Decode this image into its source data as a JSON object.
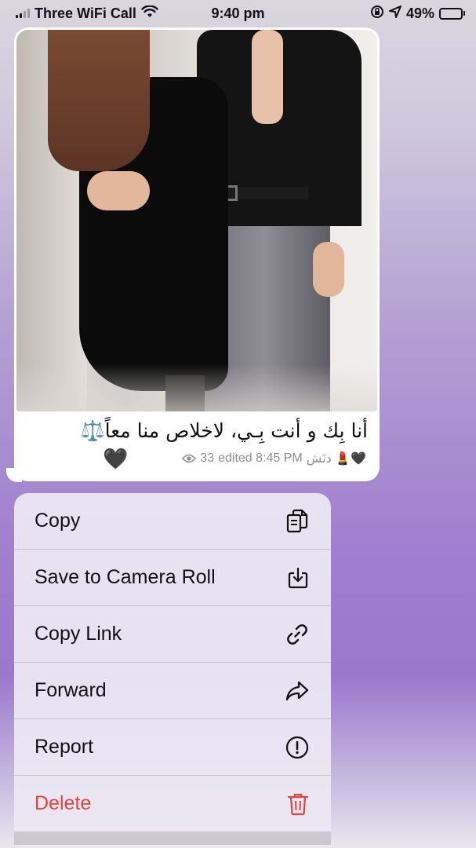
{
  "status_bar": {
    "carrier": "Three WiFi Call",
    "time": "9:40 pm",
    "battery": "49%",
    "battery_level": 0.49,
    "icons": [
      "signal-icon",
      "wifi-icon",
      "orientation-lock-icon",
      "location-arrow-icon",
      "battery-icon"
    ]
  },
  "message": {
    "caption": "أنا بِك و أنت بِـي، لاخلاص منا معاً⚖️",
    "reaction": "🖤",
    "author": "دنَش 💄🖤",
    "views": "33",
    "edited_time": "edited 8:45 PM",
    "meta_line": "33 edited 8:45 ,🖤💄 دنَش PM"
  },
  "context_menu": {
    "items": [
      {
        "label": "Copy",
        "icon": "copy-icon",
        "destructive": false
      },
      {
        "label": "Save to Camera Roll",
        "icon": "save-download-icon",
        "destructive": false
      },
      {
        "label": "Copy Link",
        "icon": "link-icon",
        "destructive": false
      },
      {
        "label": "Forward",
        "icon": "forward-arrow-icon",
        "destructive": false
      },
      {
        "label": "Report",
        "icon": "exclamation-circle-icon",
        "destructive": false
      },
      {
        "label": "Delete",
        "icon": "trash-icon",
        "destructive": true
      }
    ],
    "destructive_color": "#e0453f"
  }
}
